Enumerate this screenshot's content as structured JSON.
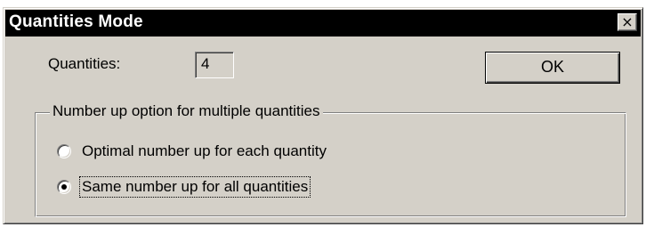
{
  "window": {
    "title": "Quantities Mode",
    "close_glyph": "×"
  },
  "quantities": {
    "label": "Quantities:",
    "value": "4"
  },
  "ok_button": {
    "label": "OK"
  },
  "number_up_group": {
    "legend": "Number up option for multiple quantities",
    "options": [
      {
        "label": "Optimal number up for each quantity",
        "selected": false
      },
      {
        "label": "Same number up for all quantities",
        "selected": true
      }
    ]
  },
  "icons": {
    "close": "close-icon",
    "radio_unselected": "radio-unselected-icon",
    "radio_selected": "radio-selected-icon"
  }
}
